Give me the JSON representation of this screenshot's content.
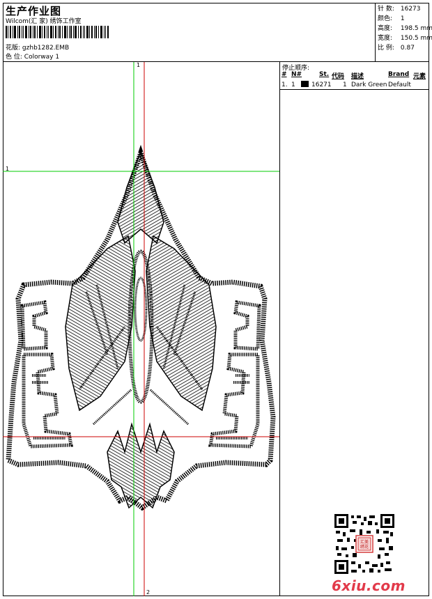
{
  "header": {
    "title": "生产作业图",
    "company": "Wilcom(汇 家) 绣饰工作室",
    "design_label": "花版:",
    "design_value": "gzhb1282.EMB",
    "colorway_label": "色 位:",
    "colorway_value": "Colorway 1"
  },
  "stats": [
    {
      "label": "针 数:",
      "value": "16273"
    },
    {
      "label": "颜色:",
      "value": "1"
    },
    {
      "label": "高度:",
      "value": "198.5 mm"
    },
    {
      "label": "宽度:",
      "value": "150.5 mm"
    },
    {
      "label": "比 例:",
      "value": "0.87"
    }
  ],
  "sequence": {
    "title": "停止顺序:",
    "headers": [
      "#",
      "N#",
      "St.",
      "代码",
      "描述",
      "Brand",
      "元素"
    ],
    "rows": [
      {
        "index": "1.",
        "needle": "1",
        "stitches": "16271",
        "code": "1",
        "description": "Dark Green",
        "brand": "Default",
        "swatch_color": "#000000"
      }
    ]
  },
  "guides": {
    "horizontal_1": "1",
    "vertical_1": "1",
    "vertical_2": "2"
  },
  "colors": {
    "guide_green": "#00cc00",
    "guide_red": "#cc0000",
    "stitch": "#000000",
    "watermark": "#e23a4a"
  },
  "watermark": "6xiu.com",
  "qr_stamp": "汇美绣花"
}
